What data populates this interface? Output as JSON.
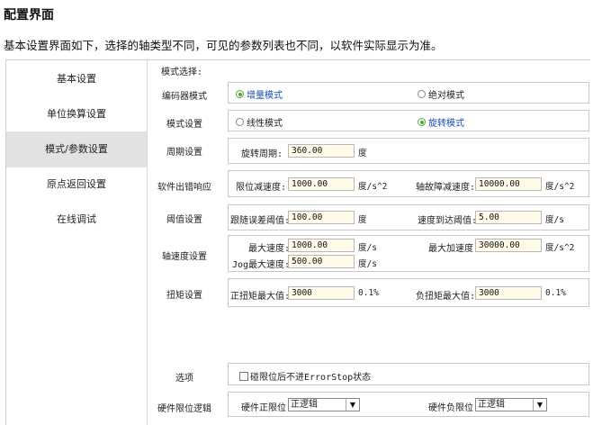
{
  "doc": {
    "title": "配置界面",
    "description": "基本设置界面如下，选择的轴类型不同，可见的参数列表也不同，以软件实际显示为准。"
  },
  "sidebar": {
    "items": [
      {
        "label": "基本设置"
      },
      {
        "label": "单位换算设置"
      },
      {
        "label": "模式/参数设置"
      },
      {
        "label": "原点返回设置"
      },
      {
        "label": "在线调试"
      }
    ],
    "active_index": 2
  },
  "content": {
    "section_title": "模式选择:",
    "encoder_mode": {
      "label": "编码器模式",
      "opt1": "增量模式",
      "opt2": "绝对模式",
      "selected": "增量模式"
    },
    "mode_setting": {
      "label": "模式设置",
      "opt1": "线性模式",
      "opt2": "旋转模式",
      "selected": "旋转模式"
    },
    "period": {
      "label": "周期设置",
      "field_label": "旋转周期:",
      "value": "360.00",
      "unit": "度"
    },
    "soft_error": {
      "label": "软件出错响应",
      "limit_decel_label": "限位减速度:",
      "limit_decel_value": "1000.00",
      "limit_decel_unit": "度/s^2",
      "fault_decel_label": "轴故障减速度:",
      "fault_decel_value": "10000.00",
      "fault_decel_unit": "度/s^2"
    },
    "threshold": {
      "label": "阈值设置",
      "follow_err_label": "跟随误差阈值:",
      "follow_err_value": "100.00",
      "follow_err_unit": "度",
      "speed_reach_label": "速度到达阈值:",
      "speed_reach_value": "5.00",
      "speed_reach_unit": "度/s"
    },
    "axis_speed": {
      "label": "轴速度设置",
      "max_speed_label": "最大速度:",
      "max_speed_value": "1000.00",
      "max_speed_unit": "度/s",
      "max_accel_label": "最大加速度:",
      "max_accel_value": "30000.00",
      "max_accel_unit": "度/s^2",
      "jog_label": "Jog最大速度:",
      "jog_value": "500.00",
      "jog_unit": "度/s"
    },
    "torque": {
      "label": "扭矩设置",
      "pos_label": "正扭矩最大值:",
      "pos_value": "3000",
      "pos_unit": "0.1%",
      "neg_label": "负扭矩最大值:",
      "neg_value": "3000",
      "neg_unit": "0.1%"
    },
    "options": {
      "label": "选项",
      "checkbox_label": "碰限位后不进ErrorStop状态",
      "checked": false
    },
    "hw_limit": {
      "label": "硬件限位逻辑",
      "pos_label": "硬件正限位:",
      "pos_value": "正逻辑",
      "neg_label": "硬件负限位:",
      "neg_value": "正逻辑"
    }
  }
}
